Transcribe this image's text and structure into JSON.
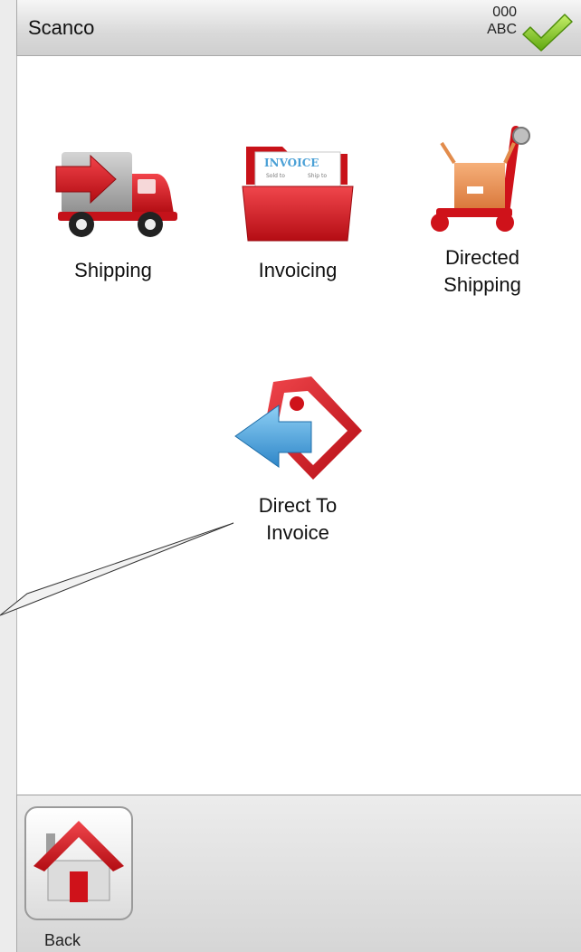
{
  "header": {
    "title": "Scanco",
    "code_top": "000",
    "code_bottom": "ABC",
    "confirm_icon": "checkmark-icon"
  },
  "menu": [
    {
      "label": "Shipping",
      "icon": "truck-icon"
    },
    {
      "label": "Invoicing",
      "icon": "invoice-folder-icon",
      "icon_text": "INVOICE",
      "icon_subtext_left": "Sold to",
      "icon_subtext_right": "Ship to"
    },
    {
      "label": "Directed\nShipping",
      "icon": "cart-with-box-icon"
    },
    {
      "label": "Direct To\nInvoice",
      "icon": "tag-with-arrow-icon"
    }
  ],
  "footer": {
    "back_label": "Back",
    "back_icon": "home-icon"
  },
  "colors": {
    "accent_red": "#d9141b",
    "check_green": "#7fc41f",
    "arrow_blue": "#3b9ad9"
  }
}
